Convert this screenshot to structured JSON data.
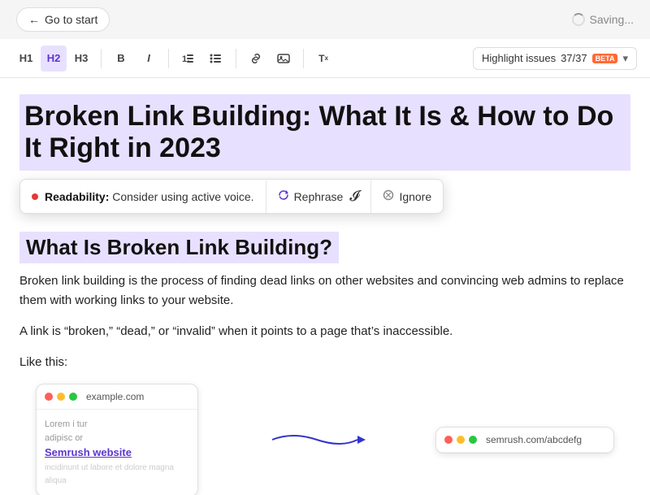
{
  "topBar": {
    "goToStart": "Go to start",
    "saving": "Saving..."
  },
  "toolbar": {
    "h1": "H1",
    "h2": "H2",
    "h3": "H3",
    "bold": "B",
    "italic": "I",
    "orderedList": "≡",
    "unorderedList": "≡",
    "link": "🔗",
    "image": "⊡",
    "clear": "Tx",
    "highlightLabel": "Highlight issues",
    "highlightCount": "37/37",
    "betaBadge": "beta",
    "chevron": "▾"
  },
  "content": {
    "mainHeading": "Broken Link Building: What It Is & How to Do It Right in 2023",
    "readability": {
      "dot": "●",
      "label": "Readability:",
      "text": "Consider using active voice.",
      "rephraseBtn": "Rephrase",
      "ignoreBtn": "Ignore"
    },
    "sectionHeading": "What Is Broken Link Building?",
    "paragraph1": "Broken link building is the process of finding dead links on other websites and convincing web admins to replace them with working links to your website.",
    "paragraph2": "A link is “broken,” “dead,” or “invalid” when it points to a page that’s inaccessible.",
    "paragraph3": "Like this:",
    "example": {
      "sourceUrl": "example.com",
      "sourceBody1": "Lorem i",
      "sourceBody2": "tur",
      "sourceBody3": "adipisc",
      "sourceBody4": "or",
      "sourceBody5": "incidinunt ut labore et dolore magna aliqua",
      "linkText": "Semrush website",
      "destUrl": "semrush.com/abcdefg"
    }
  }
}
